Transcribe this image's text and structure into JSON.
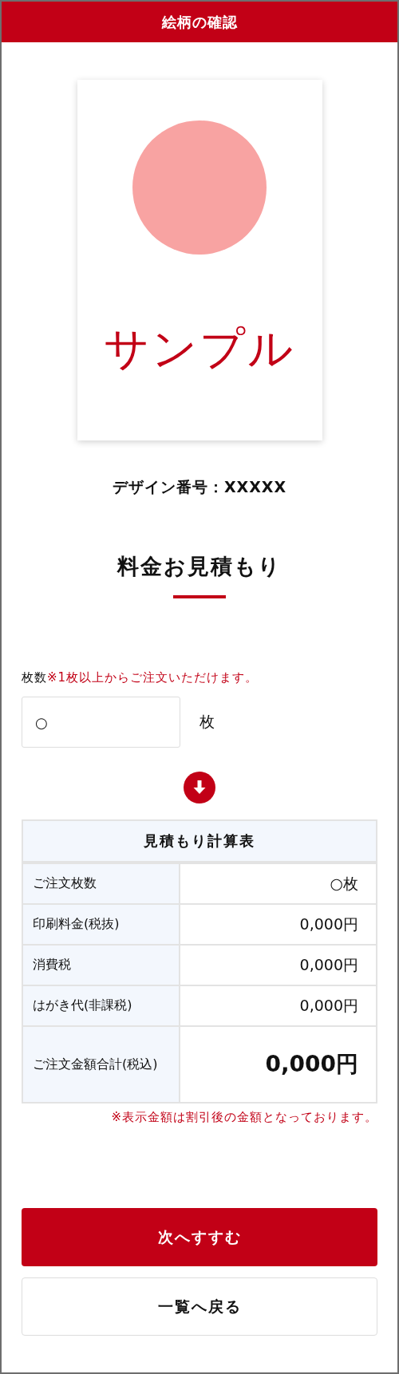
{
  "header": {
    "title": "絵柄の確認"
  },
  "design": {
    "sample_text": "サンプル",
    "number": "デザイン番号：XXXXX"
  },
  "estimate": {
    "heading": "料金お見積もり"
  },
  "quantity": {
    "label": "枚数",
    "note": "※1枚以上からご注文いただけます。",
    "value": "○",
    "unit": "枚"
  },
  "table": {
    "title": "見積もり計算表",
    "rows": [
      {
        "kind": "normal",
        "label": "ご注文枚数",
        "value": "○枚"
      },
      {
        "kind": "normal",
        "label": "印刷料金(税抜)",
        "value": "0,000円"
      },
      {
        "kind": "normal",
        "label": "消費税",
        "value": "0,000円"
      },
      {
        "kind": "normal",
        "label": "はがき代(非課税)",
        "value": "0,000円"
      },
      {
        "kind": "total",
        "label": "ご注文金額合計(税込)",
        "value": "0,000円"
      }
    ],
    "note": "※表示金額は割引後の金額となっております。"
  },
  "buttons": [
    {
      "kind": "primary",
      "label": "次へすすむ"
    },
    {
      "kind": "secondary",
      "label": "一覧へ戻る"
    }
  ]
}
